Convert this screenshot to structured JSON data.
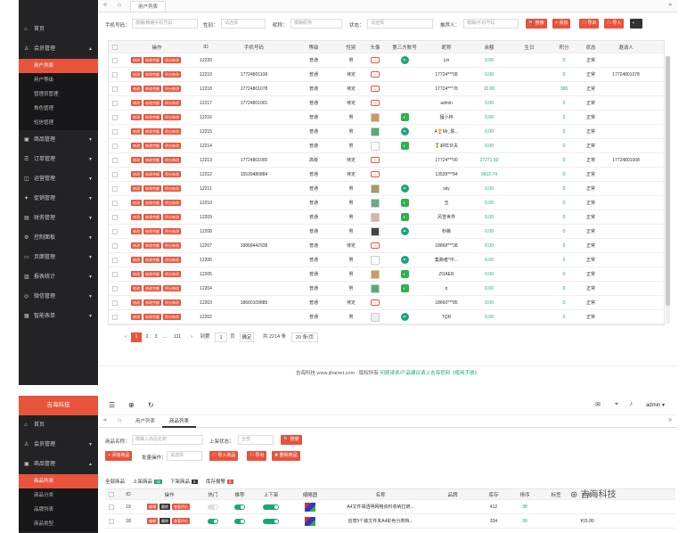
{
  "screen1": {
    "sidebar": {
      "items": [
        {
          "label": "首页",
          "icon": "home-icon"
        },
        {
          "label": "会员管理",
          "icon": "user-icon",
          "open": true
        },
        {
          "label": "商品管理",
          "icon": "box-icon"
        },
        {
          "label": "订单管理",
          "icon": "order-icon"
        },
        {
          "label": "运营管理",
          "icon": "chart-icon"
        },
        {
          "label": "促销管理",
          "icon": "gift-icon"
        },
        {
          "label": "财务管理",
          "icon": "wallet-icon"
        },
        {
          "label": "控制面板",
          "icon": "gear-icon"
        },
        {
          "label": "页面管理",
          "icon": "page-icon"
        },
        {
          "label": "报表统计",
          "icon": "report-icon"
        },
        {
          "label": "微信管理",
          "icon": "wechat-icon"
        },
        {
          "label": "智能表单",
          "icon": "form-icon"
        }
      ],
      "sub_items": [
        "用户列表",
        "用户等级",
        "管理员管理",
        "角色管理",
        "短信管理"
      ]
    },
    "tab_label": "用户列表",
    "filters": {
      "phone_label": "手机号码：",
      "phone_ph": "模糊/精确手机号码",
      "gender_label": "性别：",
      "gender_ph": "请选择",
      "nick_label": "昵称：",
      "nick_ph": "模糊昵称",
      "status_label": "状态：",
      "status_ph": "请选择",
      "referrer_label": "推荐人：",
      "referrer_ph": "模糊/手机号码",
      "search_btn": "搜索",
      "add_btn": "添加",
      "export_btn": "导出",
      "import_btn": "导入"
    },
    "columns": [
      "操作",
      "ID",
      "手机号码",
      "等级",
      "性别",
      "头像",
      "第三方账号",
      "昵称",
      "余额",
      "生日",
      "积分",
      "状态",
      "邀请人"
    ],
    "actions": [
      "修改",
      "修改余额",
      "积分修改"
    ],
    "rows": [
      {
        "id": "12220",
        "phone": "",
        "level": "普通",
        "gender": "男",
        "third": "link",
        "nick": "Lin",
        "balance": "0.00",
        "points": "0",
        "status": "正常",
        "inviter": ""
      },
      {
        "id": "12219",
        "phone": "17724801108",
        "level": "普通",
        "gender": "待定",
        "third": "",
        "nick": "17724***08",
        "balance": "0.00",
        "points": "0",
        "status": "正常",
        "inviter": "17724801078"
      },
      {
        "id": "12218",
        "phone": "17724801078",
        "level": "普通",
        "gender": "待定",
        "third": "",
        "nick": "17724***78",
        "balance": "10.00",
        "points": "300",
        "status": "正常",
        "inviter": ""
      },
      {
        "id": "12217",
        "phone": "17724801001",
        "level": "普通",
        "gender": "待定",
        "third": "",
        "nick": "admin",
        "balance": "0.00",
        "points": "0",
        "status": "正常",
        "inviter": ""
      },
      {
        "id": "12216",
        "phone": "",
        "level": "普通",
        "gender": "男",
        "third": "wechat",
        "nick": "擅小林",
        "balance": "0.00",
        "points": "0",
        "status": "正常",
        "inviter": ""
      },
      {
        "id": "12215",
        "phone": "",
        "level": "普通",
        "gender": "男",
        "third": "link",
        "nick": "A🏆Mr_陈...",
        "balance": "0.00",
        "points": "0",
        "status": "正常",
        "inviter": ""
      },
      {
        "id": "12214",
        "phone": "",
        "level": "普通",
        "gender": "男",
        "third": "wechat",
        "nick": "🏅斜杠伙夫",
        "balance": "0.00",
        "points": "0",
        "status": "正常",
        "inviter": ""
      },
      {
        "id": "12213",
        "phone": "17724801000",
        "level": "高级",
        "gender": "待定",
        "third": "",
        "nick": "17724***00",
        "balance": "27271.50",
        "points": "0",
        "status": "正常",
        "inviter": "17724801008"
      },
      {
        "id": "12212",
        "phone": "15539480884",
        "level": "普通",
        "gender": "待定",
        "third": "",
        "nick": "13539***84",
        "balance": "9612.74",
        "points": "0",
        "status": "正常",
        "inviter": ""
      },
      {
        "id": "12211",
        "phone": "",
        "level": "普通",
        "gender": "男",
        "third": "link",
        "nick": "sky",
        "balance": "0.00",
        "points": "0",
        "status": "正常",
        "inviter": ""
      },
      {
        "id": "12210",
        "phone": "",
        "level": "普通",
        "gender": "男",
        "third": "wechat",
        "nick": "玉",
        "balance": "0.00",
        "points": "0",
        "status": "正常",
        "inviter": ""
      },
      {
        "id": "12209",
        "phone": "",
        "level": "普通",
        "gender": "男",
        "third": "wechat",
        "nick": "风雪世界",
        "balance": "0.00",
        "points": "0",
        "status": "正常",
        "inviter": ""
      },
      {
        "id": "12208",
        "phone": "",
        "level": "普通",
        "gender": "男",
        "third": "link",
        "nick": "秒薇",
        "balance": "0.00",
        "points": "0",
        "status": "正常",
        "inviter": ""
      },
      {
        "id": "12207",
        "phone": "18868442938",
        "level": "普通",
        "gender": "待定",
        "third": "",
        "nick": "18868***38",
        "balance": "0.00",
        "points": "0",
        "status": "正常",
        "inviter": ""
      },
      {
        "id": "12206",
        "phone": "",
        "level": "普通",
        "gender": "男",
        "third": "link",
        "nick": "集跑者*中...",
        "balance": "0.00",
        "points": "0",
        "status": "正常",
        "inviter": ""
      },
      {
        "id": "12205",
        "phone": "",
        "level": "普通",
        "gender": "男",
        "third": "wechat",
        "nick": "ZOAER",
        "balance": "0.00",
        "points": "0",
        "status": "正常",
        "inviter": ""
      },
      {
        "id": "12204",
        "phone": "",
        "level": "普通",
        "gender": "男",
        "third": "wechat",
        "nick": "α",
        "balance": "0.00",
        "points": "0",
        "status": "正常",
        "inviter": ""
      },
      {
        "id": "12203",
        "phone": "18660109885",
        "level": "普通",
        "gender": "待定",
        "third": "",
        "nick": "18660***85",
        "balance": "0.00",
        "points": "0",
        "status": "正常",
        "inviter": ""
      },
      {
        "id": "12202",
        "phone": "",
        "level": "普通",
        "gender": "男",
        "third": "link",
        "nick": "TQR",
        "balance": "0.00",
        "points": "0",
        "status": "正常",
        "inviter": ""
      }
    ],
    "pager": {
      "pages": [
        "1",
        "2",
        "3",
        "...",
        "111"
      ],
      "goto": "到第",
      "goto_val": "1",
      "unit": "页",
      "confirm": "确定",
      "total": "共 2214 条",
      "per": "20 条/页"
    },
    "footer": {
      "copy": "吉海科技 www.jihainet.com · 版权所有",
      "link": "问题请求/产品建议请上吉海官网《使用手册》"
    }
  },
  "screen2": {
    "logo": "吉海科技",
    "sidebar": [
      {
        "label": "首页",
        "icon": "home-icon"
      },
      {
        "label": "会员管理",
        "icon": "user-icon"
      },
      {
        "label": "商品管理",
        "icon": "box-icon"
      }
    ],
    "sub_items": [
      "商品列表",
      "商品分类",
      "品牌列表",
      "商品类型"
    ],
    "tabs": [
      "用户列表",
      "商品列表"
    ],
    "admin": "admin",
    "filters": {
      "name_label": "商品名称：",
      "name_ph": "模糊入商品名称",
      "status_label": "上架状态：",
      "status_ph": "全部",
      "search": "搜索",
      "add": "添加商品",
      "batch_label": "批量操作：",
      "batch_ph": "请选择",
      "import": "导入商品",
      "export": "导出",
      "delete": "删除商品"
    },
    "goods_tabs": [
      {
        "label": "全部商品",
        "count": ""
      },
      {
        "label": "上架商品",
        "count": "18"
      },
      {
        "label": "下架商品",
        "count": "0"
      },
      {
        "label": "库存报警",
        "count": "0"
      }
    ],
    "columns": [
      "ID",
      "操作",
      "热门",
      "推荐",
      "上下架",
      "缩略图",
      "名称",
      "品牌",
      "库存",
      "排序",
      "标签",
      "价格"
    ],
    "actions": [
      "编辑",
      "删除",
      "查看评价"
    ],
    "rows": [
      {
        "id": "19",
        "name": "A4文件袋透明网格资料收纳拉链...",
        "stock": "412",
        "sort": "98",
        "price": ""
      },
      {
        "id": "18",
        "name": "创意5个装文件夹A4彩色分类档...",
        "stock": "334",
        "sort": "99",
        "price": "¥15.80",
        "price2": "¥6.00"
      }
    ],
    "watermark": "吉海科技"
  },
  "colors": {
    "accent": "#e8533c",
    "green": "#1fa37c",
    "sidebar": "#232326"
  }
}
